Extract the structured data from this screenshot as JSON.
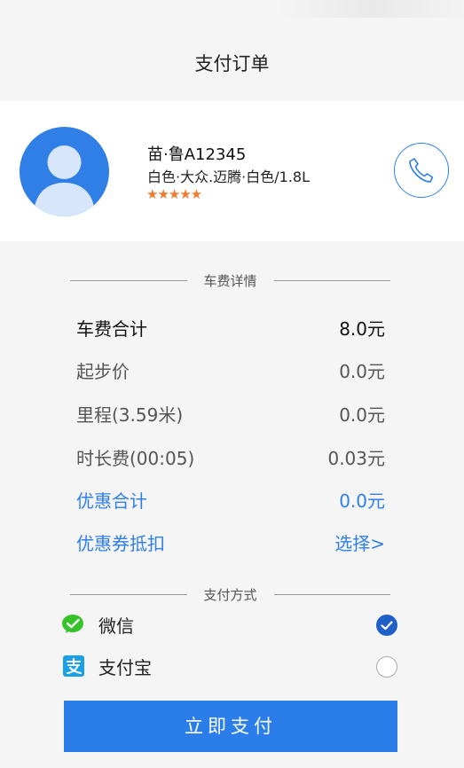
{
  "page_title": "支付订单",
  "driver": {
    "plate": "苗·鲁A12345",
    "car": "白色·大众.迈腾·白色/1.8L",
    "rating_stars": "★★★★★",
    "rating": 5
  },
  "fare_section": {
    "header": "车费详情",
    "total": {
      "label": "车费合计",
      "value": "8.0元"
    },
    "items": [
      {
        "label": "起步价",
        "value": "0.0元"
      },
      {
        "label": "里程(3.59米)",
        "value": "0.0元"
      },
      {
        "label": "时长费(00:05)",
        "value": "0.03元"
      }
    ],
    "discount": {
      "label": "优惠合计",
      "value": "0.0元"
    },
    "coupon": {
      "label": "优惠券抵扣",
      "value": "选择>"
    }
  },
  "payment_section": {
    "header": "支付方式",
    "methods": [
      {
        "label": "微信",
        "selected": true,
        "icon": "wechat-icon"
      },
      {
        "label": "支付宝",
        "selected": false,
        "icon": "alipay-icon"
      }
    ]
  },
  "pay_button": "立即支付",
  "colors": {
    "accent": "#2b7de9",
    "star": "#f07a2d",
    "wechat": "#36c22a",
    "alipay": "#1aa0e4"
  }
}
